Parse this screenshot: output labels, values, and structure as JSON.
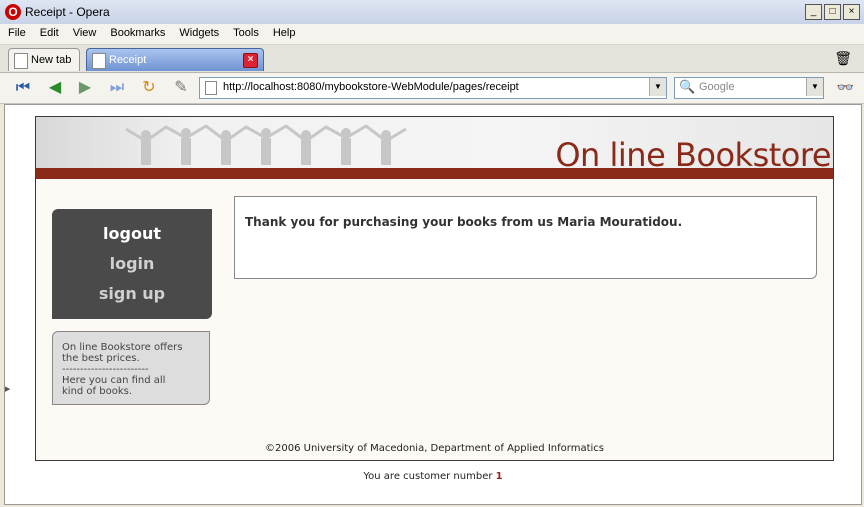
{
  "window": {
    "title": "Receipt - Opera",
    "buttons": [
      "_",
      "□",
      "×"
    ]
  },
  "menubar": [
    "File",
    "Edit",
    "View",
    "Bookmarks",
    "Widgets",
    "Tools",
    "Help"
  ],
  "tabs": [
    {
      "label": "New tab"
    },
    {
      "label": "Receipt"
    }
  ],
  "address": {
    "url": "http://localhost:8080/mybookstore-WebModule/pages/receipt"
  },
  "search": {
    "placeholder": "Google"
  },
  "site": {
    "banner_title": "On line Bookstore",
    "menu": [
      "logout",
      "login",
      "sign up"
    ],
    "promo_lines": [
      "On line Bookstore offers",
      "the best prices.",
      "------------------------",
      "Here you can find all",
      "kind of books."
    ],
    "message": "Thank you for purchasing your books from us Maria Mouratidou.",
    "copyright": "©2006 University of Macedonia, Department of Applied Informatics",
    "customer_label": "You are customer number",
    "customer_number": "1"
  },
  "colors": {
    "brand": "#8c2a1a",
    "menu_bg": "#4a4a4a",
    "active_tab": "#6f93d3"
  }
}
